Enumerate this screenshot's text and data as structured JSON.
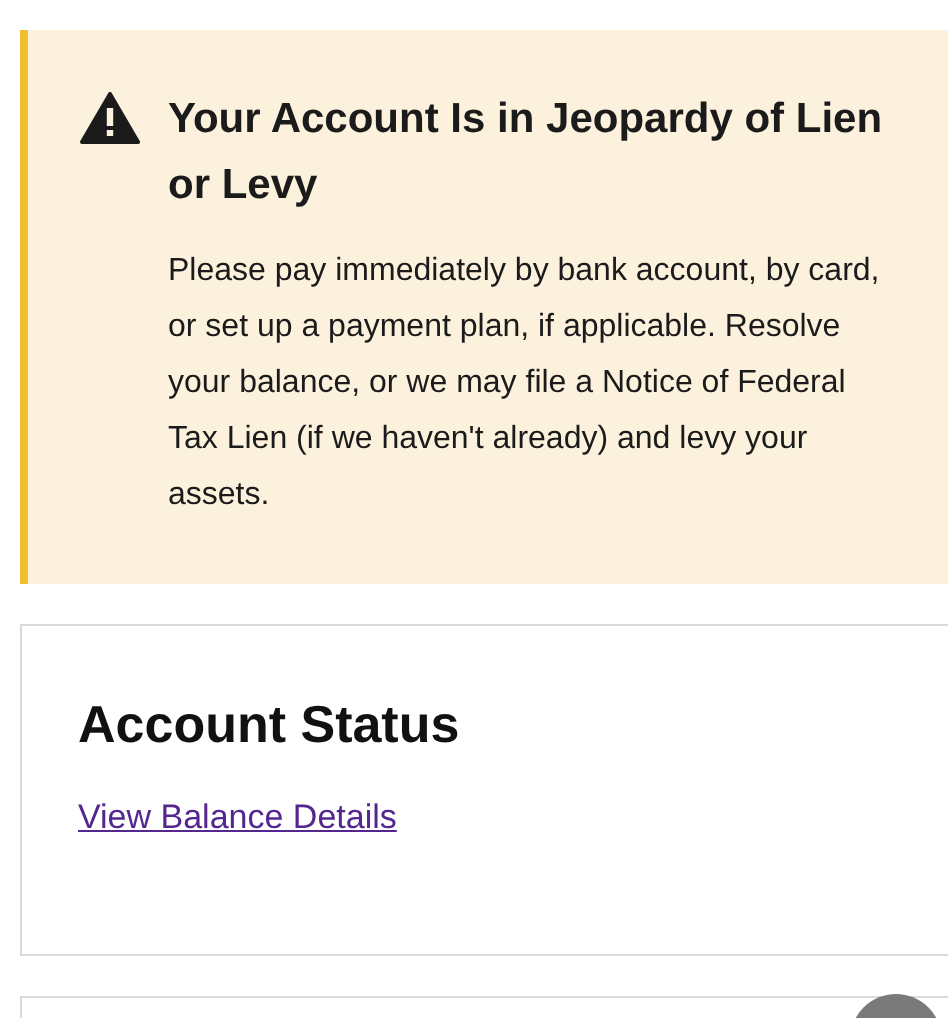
{
  "alert": {
    "title": "Your Account Is in Jeopardy of Lien or Levy",
    "body": "Please pay immediately by bank account, by card, or set up a payment plan, if applicable. Resolve your balance, or we may file a Notice of Federal Tax Lien (if we haven't already) and levy your assets."
  },
  "account_status": {
    "heading": "Account Status",
    "link": "View Balance Details"
  }
}
